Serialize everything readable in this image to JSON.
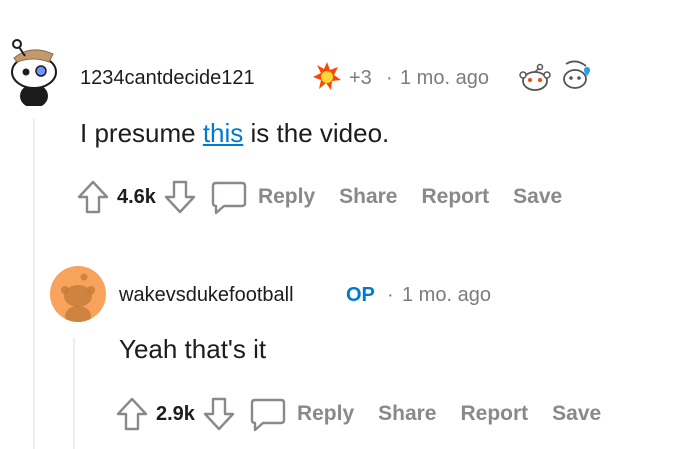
{
  "comments": [
    {
      "username": "1234cantdecide121",
      "award_count": "+3",
      "separator": "·",
      "time": "1 mo. ago",
      "body_prefix": "I presume ",
      "body_link": "this",
      "body_suffix": " is the video.",
      "score": "4.6k",
      "actions": {
        "reply": "Reply",
        "share": "Share",
        "report": "Report",
        "save": "Save"
      }
    },
    {
      "username": "wakevsdukefootball",
      "op_badge": "OP",
      "separator": "·",
      "time": "1 mo. ago",
      "body": "Yeah that's it",
      "score": "2.9k",
      "actions": {
        "reply": "Reply",
        "share": "Share",
        "report": "Report",
        "save": "Save"
      }
    }
  ],
  "colors": {
    "link": "#0079d3",
    "muted": "#878a8c",
    "avatar_orange": "#f7a35c"
  },
  "icons": [
    "snoo-avatar-icon",
    "award-fire-icon",
    "award-snoo-icon",
    "award-heart-icon",
    "upvote-icon",
    "downvote-icon",
    "comment-icon"
  ]
}
